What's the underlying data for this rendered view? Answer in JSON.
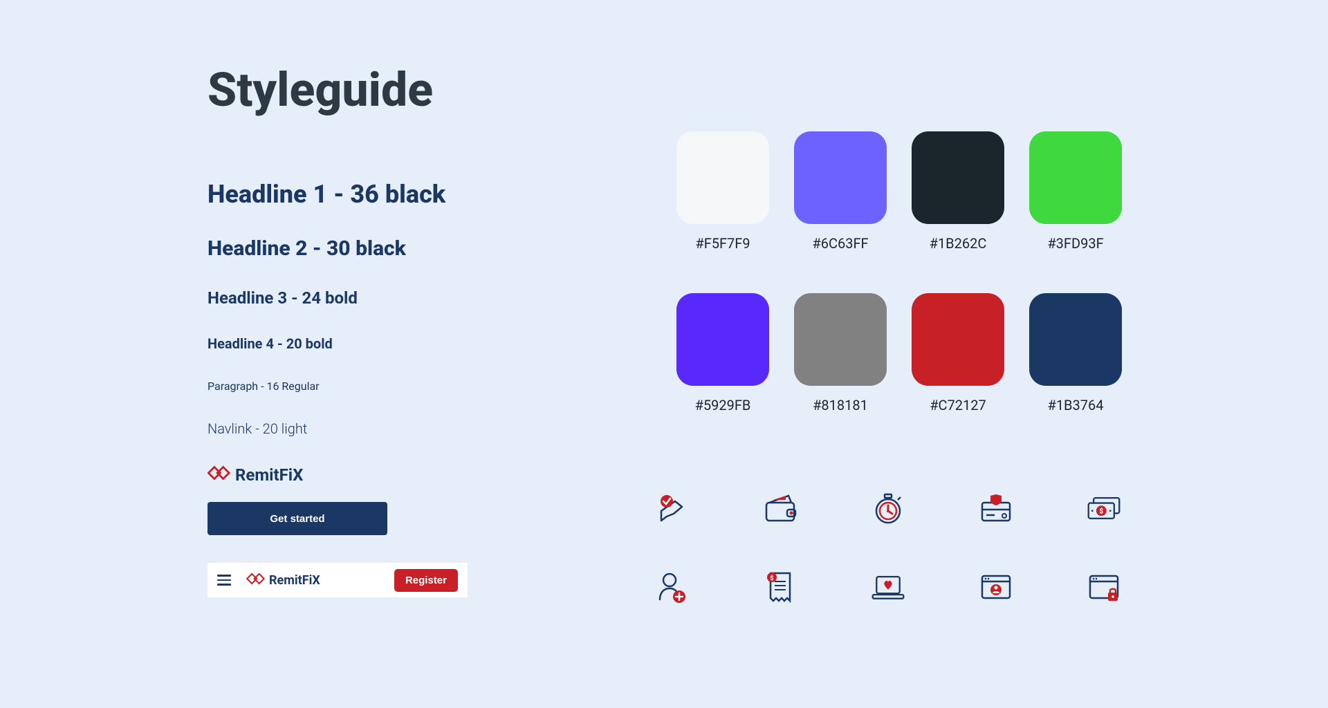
{
  "page_title": "Styleguide",
  "typography": {
    "h1": "Headline 1 - 36 black",
    "h2": "Headline 2 -  30 black",
    "h3": "Headline 3 - 24 bold",
    "h4": "Headline 4 - 20 bold",
    "p": "Paragraph - 16 Regular",
    "nav": "Navlink - 20 light"
  },
  "brand": {
    "name": "RemitFiX",
    "cta_label": "Get started",
    "register_label": "Register"
  },
  "colors": [
    {
      "hex": "#F5F7F9"
    },
    {
      "hex": "#6C63FF"
    },
    {
      "hex": "#1B262C"
    },
    {
      "hex": "#3FD93F"
    },
    {
      "hex": "#5929FB"
    },
    {
      "hex": "#818181"
    },
    {
      "hex": "#C72127"
    },
    {
      "hex": "#1B3764"
    }
  ],
  "icons": [
    "transfer-check-icon",
    "wallet-icon",
    "stopwatch-icon",
    "secure-card-icon",
    "cash-icon",
    "add-user-icon",
    "receipt-icon",
    "laptop-love-icon",
    "account-window-icon",
    "lock-window-icon"
  ]
}
